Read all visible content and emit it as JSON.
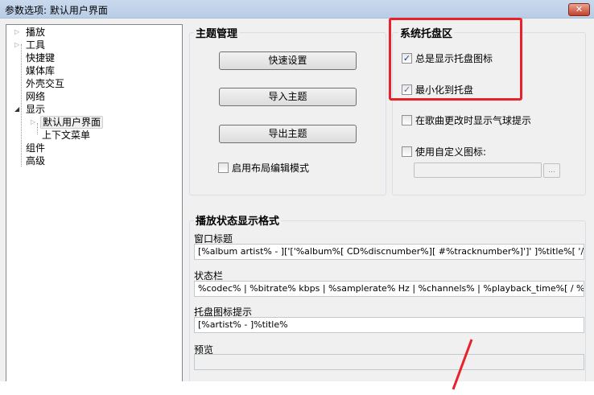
{
  "window": {
    "title": "参数选项: 默认用户界面",
    "close_label": "✕"
  },
  "tree": {
    "items": [
      {
        "label": "播放",
        "expander": "▷"
      },
      {
        "label": "工具",
        "expander": "▷"
      },
      {
        "label": "快捷键"
      },
      {
        "label": "媒体库"
      },
      {
        "label": "外壳交互"
      },
      {
        "label": "网络"
      },
      {
        "label": "显示",
        "expander": "◢"
      },
      {
        "label": "默认用户界面",
        "expander": "▷"
      },
      {
        "label": "上下文菜单"
      },
      {
        "label": "组件"
      },
      {
        "label": "高级"
      }
    ]
  },
  "theme": {
    "title": "主题管理",
    "quick_setup": "快速设置",
    "import": "导入主题",
    "export": "导出主题",
    "layout_edit": {
      "label": "启用布局编辑模式",
      "checked": false
    }
  },
  "tray": {
    "title": "系统托盘区",
    "always_show": {
      "label": "总是显示托盘图标",
      "checked": true
    },
    "minimize": {
      "label": "最小化到托盘",
      "checked": true
    },
    "balloon": {
      "label": "在歌曲更改时显示气球提示",
      "checked": false
    },
    "custom_icon": {
      "label": "使用自定义图标:",
      "checked": false
    },
    "custom_icon_path": "",
    "browse": "..."
  },
  "format": {
    "title": "播放状态显示格式",
    "window_title_label": "窗口标题",
    "window_title": "[%album artist% - ]['['%album%[ CD%discnumber%][ #%tracknumber%]']' ]%title%[ '//' %track a",
    "status_label": "状态栏",
    "status": "%codec% | %bitrate% kbps | %samplerate% Hz | %channels% | %playback_time%[ / %length%]",
    "tray_tip_label": "托盘图标提示",
    "tray_tip": "[%artist% - ]%title%",
    "preview_label": "预览",
    "preview": ""
  },
  "colors": {
    "highlight": "#e8212a"
  }
}
